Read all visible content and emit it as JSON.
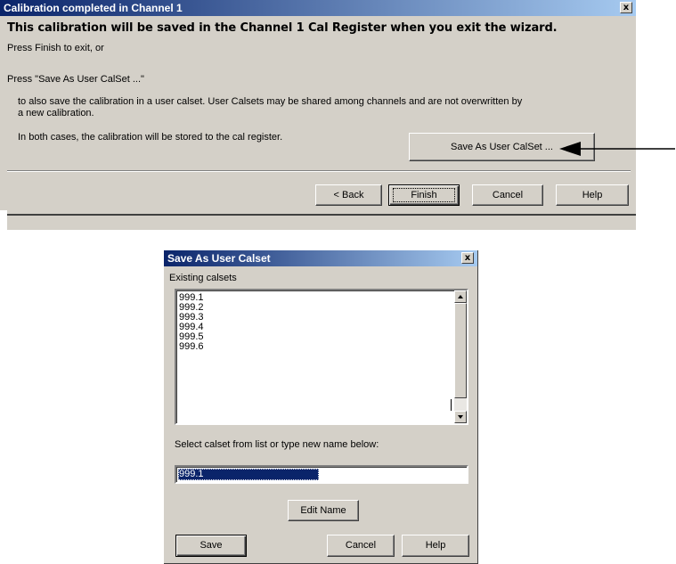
{
  "wizard": {
    "title": "Calibration completed in Channel 1",
    "close_glyph": "x",
    "heading": "This calibration will be saved in the Channel 1 Cal Register when you exit the wizard.",
    "line1": "Press Finish to exit, or",
    "line2": "Press \"Save As User CalSet ...\"",
    "line3a": "to also save the calibration in a user calset.  User Calsets may be shared among channels and are not overwritten by",
    "line3b": "a new calibration.",
    "line4": "In both cases, the calibration will be stored to the cal register.",
    "save_as_label": "Save As User CalSet ...",
    "back_label": "< Back",
    "finish_label": "Finish",
    "cancel_label": "Cancel",
    "help_label": "Help"
  },
  "calset_dialog": {
    "title": "Save As User Calset",
    "close_glyph": "x",
    "existing_label": "Existing calsets",
    "calsets": [
      "999.1",
      "999.2",
      "999.3",
      "999.4",
      "999.5",
      "999.6"
    ],
    "select_label": "Select calset from list or type new name below:",
    "name_value": "999.1",
    "edit_name_label": "Edit Name",
    "save_label": "Save",
    "cancel_label": "Cancel",
    "help_label": "Help"
  }
}
